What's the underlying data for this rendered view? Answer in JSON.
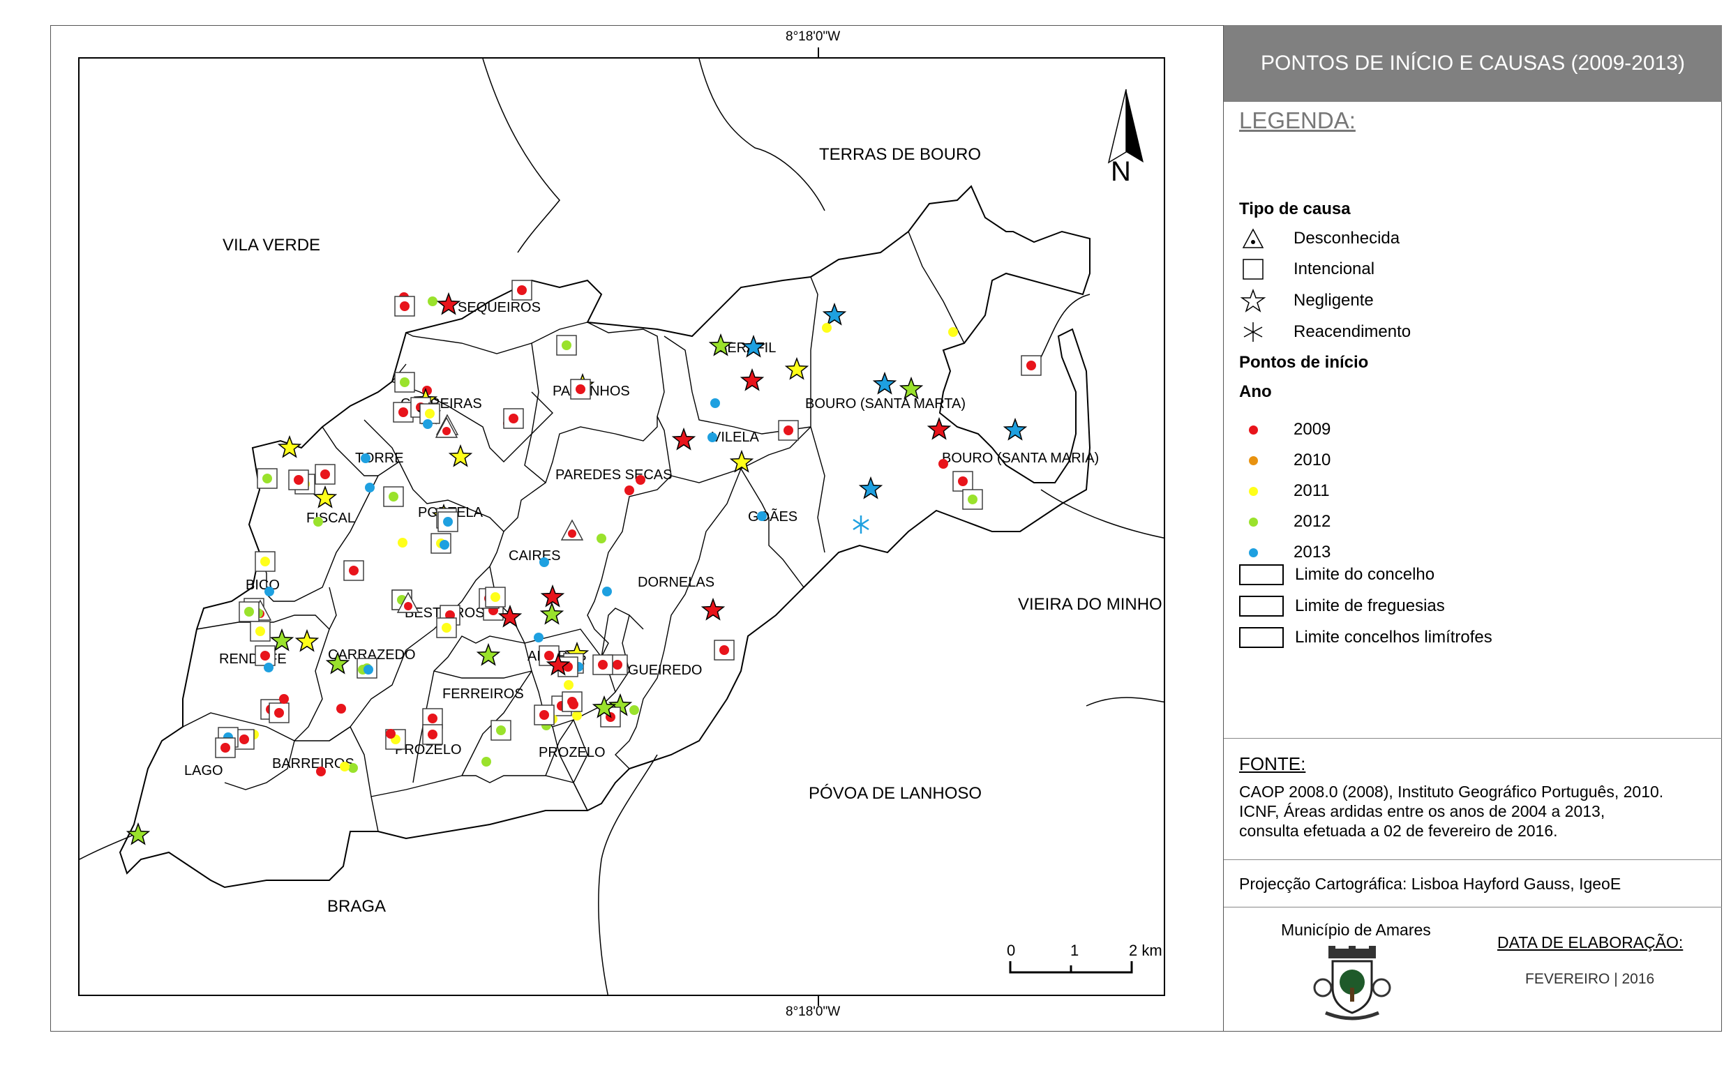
{
  "map": {
    "coord_top": "8°18'0\"W",
    "coord_bottom": "8°18'0\"W",
    "north_label": "N",
    "outer_labels": [
      {
        "text": "VILA VERDE"
      },
      {
        "text": "TERRAS DE BOURO"
      },
      {
        "text": "VIEIRA DO MINHO"
      },
      {
        "text": "PÓVOA DE LANHOSO"
      },
      {
        "text": "BRAGA"
      }
    ],
    "parish_labels": [
      "SEQUEIROS",
      "CARREIRAS",
      "PAREDES SECAS",
      "SERAFIL",
      "BOURO (SANTA MARTA)",
      "BOURO (SANTA MARIA)",
      "VILELA",
      "GOÃES",
      "TORRE",
      "PORTELA",
      "FISCAL",
      "CAIRES",
      "DORNELAS",
      "BICO",
      "BESTEIROS",
      "RENDUFE",
      "CARRAZEDO",
      "AMARES",
      "FIGUEIREDO",
      "FERREIROS",
      "LAGO",
      "BARREIROS",
      "PROZELO",
      "PROZELO",
      "PARANHOS"
    ],
    "scale": {
      "labels": [
        "0",
        "1",
        "2 km"
      ]
    }
  },
  "panel": {
    "title": "PONTOS DE INÍCIO E CAUSAS (2009-2013)",
    "legend_title": "LEGENDA:",
    "cause_heading": "Tipo de causa",
    "causes": [
      {
        "label": "Desconhecida",
        "icon": "triangle-dot-icon"
      },
      {
        "label": "Intencional",
        "icon": "square-icon"
      },
      {
        "label": "Negligente",
        "icon": "star-icon"
      },
      {
        "label": "Reacendimento",
        "icon": "asterisk-icon"
      }
    ],
    "points_heading": "Pontos de início",
    "year_heading": "Ano",
    "years": [
      {
        "label": "2009",
        "color": "#e8141b"
      },
      {
        "label": "2010",
        "color": "#e8920f"
      },
      {
        "label": "2011",
        "color": "#ffff1a"
      },
      {
        "label": "2012",
        "color": "#9ae22c"
      },
      {
        "label": "2013",
        "color": "#1ea0e0"
      }
    ],
    "limits": [
      "Limite do concelho",
      "Limite de freguesias",
      "Limite concelhos limítrofes"
    ],
    "fonte_title": "FONTE:",
    "fonte_lines": [
      "CAOP 2008.0 (2008), Instituto Geográfico Português, 2010.",
      "ICNF, Áreas ardidas entre os anos de 2004 a 2013,",
      "consulta efetuada a 02 de fevereiro de 2016."
    ],
    "projection": "Projecção Cartográfica: Lisboa Hayford Gauss, IgeoE",
    "municipality": "Município de Amares",
    "date_label": "DATA DE ELABORAÇÃO:",
    "date_value": "FEVEREIRO | 2016"
  }
}
